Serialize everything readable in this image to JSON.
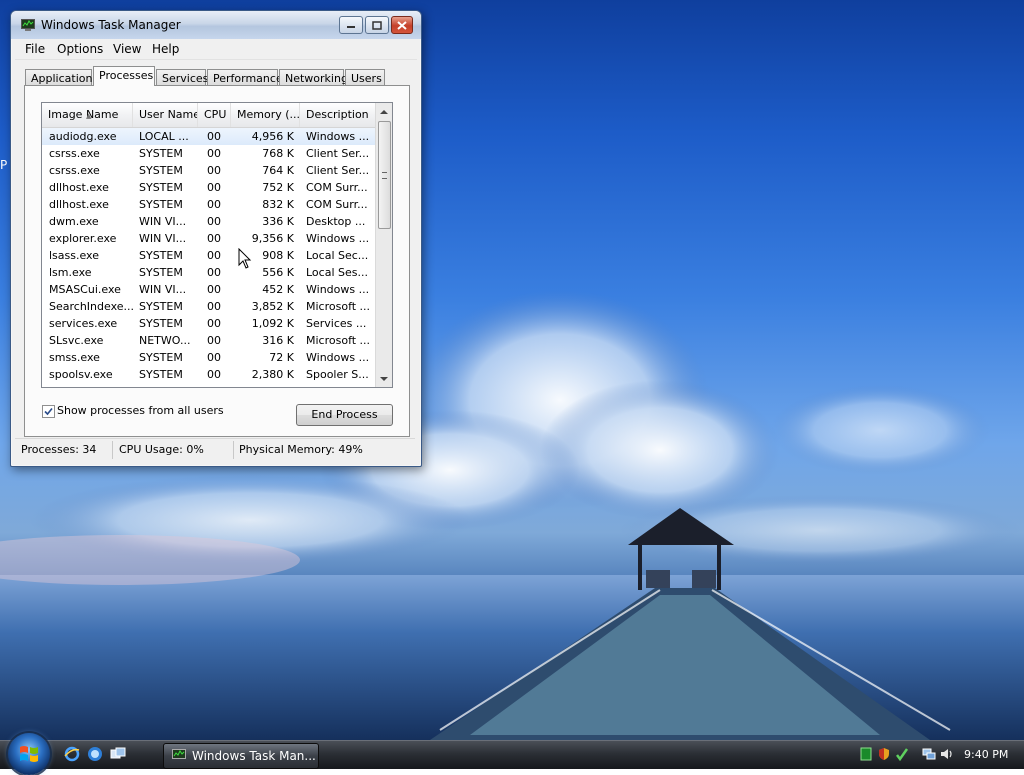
{
  "window": {
    "title": "Windows Task Manager",
    "menu": [
      "File",
      "Options",
      "View",
      "Help"
    ],
    "tabs": [
      "Applications",
      "Processes",
      "Services",
      "Performance",
      "Networking",
      "Users"
    ],
    "active_tab": "Processes"
  },
  "processes": {
    "columns": [
      "Image Name",
      "User Name",
      "CPU",
      "Memory (...",
      "Description"
    ],
    "rows": [
      {
        "image": "audiodg.exe",
        "user": "LOCAL ...",
        "cpu": "00",
        "memory": "4,956 K",
        "desc": "Windows ..."
      },
      {
        "image": "csrss.exe",
        "user": "SYSTEM",
        "cpu": "00",
        "memory": "768 K",
        "desc": "Client Ser..."
      },
      {
        "image": "csrss.exe",
        "user": "SYSTEM",
        "cpu": "00",
        "memory": "764 K",
        "desc": "Client Ser..."
      },
      {
        "image": "dllhost.exe",
        "user": "SYSTEM",
        "cpu": "00",
        "memory": "752 K",
        "desc": "COM Surr..."
      },
      {
        "image": "dllhost.exe",
        "user": "SYSTEM",
        "cpu": "00",
        "memory": "832 K",
        "desc": "COM Surr..."
      },
      {
        "image": "dwm.exe",
        "user": "WIN VI...",
        "cpu": "00",
        "memory": "336 K",
        "desc": "Desktop ..."
      },
      {
        "image": "explorer.exe",
        "user": "WIN VI...",
        "cpu": "00",
        "memory": "9,356 K",
        "desc": "Windows ..."
      },
      {
        "image": "lsass.exe",
        "user": "SYSTEM",
        "cpu": "00",
        "memory": "908 K",
        "desc": "Local Sec..."
      },
      {
        "image": "lsm.exe",
        "user": "SYSTEM",
        "cpu": "00",
        "memory": "556 K",
        "desc": "Local Ses..."
      },
      {
        "image": "MSASCui.exe",
        "user": "WIN VI...",
        "cpu": "00",
        "memory": "452 K",
        "desc": "Windows ..."
      },
      {
        "image": "SearchIndexe...",
        "user": "SYSTEM",
        "cpu": "00",
        "memory": "3,852 K",
        "desc": "Microsoft ..."
      },
      {
        "image": "services.exe",
        "user": "SYSTEM",
        "cpu": "00",
        "memory": "1,092 K",
        "desc": "Services ..."
      },
      {
        "image": "SLsvc.exe",
        "user": "NETWO...",
        "cpu": "00",
        "memory": "316 K",
        "desc": "Microsoft ..."
      },
      {
        "image": "smss.exe",
        "user": "SYSTEM",
        "cpu": "00",
        "memory": "72 K",
        "desc": "Windows ..."
      },
      {
        "image": "spoolsv.exe",
        "user": "SYSTEM",
        "cpu": "00",
        "memory": "2,380 K",
        "desc": "Spooler S..."
      }
    ],
    "selected_row": "audiodg.exe",
    "show_all_users_label": "Show processes from all users",
    "show_all_users_checked": true,
    "end_process_label": "End Process"
  },
  "status": {
    "processes": "Processes: 34",
    "cpu": "CPU Usage: 0%",
    "memory": "Physical Memory: 49%"
  },
  "desktop": {
    "edge_text": "P"
  },
  "taskbar": {
    "task_button": "Windows Task Man...",
    "clock": "9:40 PM"
  },
  "icons": {
    "start": "windows-start-orb-icon",
    "quick_launch": [
      "internet-explorer-icon",
      "windows-explorer-icon",
      "switch-windows-icon"
    ],
    "tray": [
      "network-activity-icon",
      "security-shield-icon",
      "defender-icon",
      "network-connection-icon",
      "volume-icon"
    ]
  }
}
